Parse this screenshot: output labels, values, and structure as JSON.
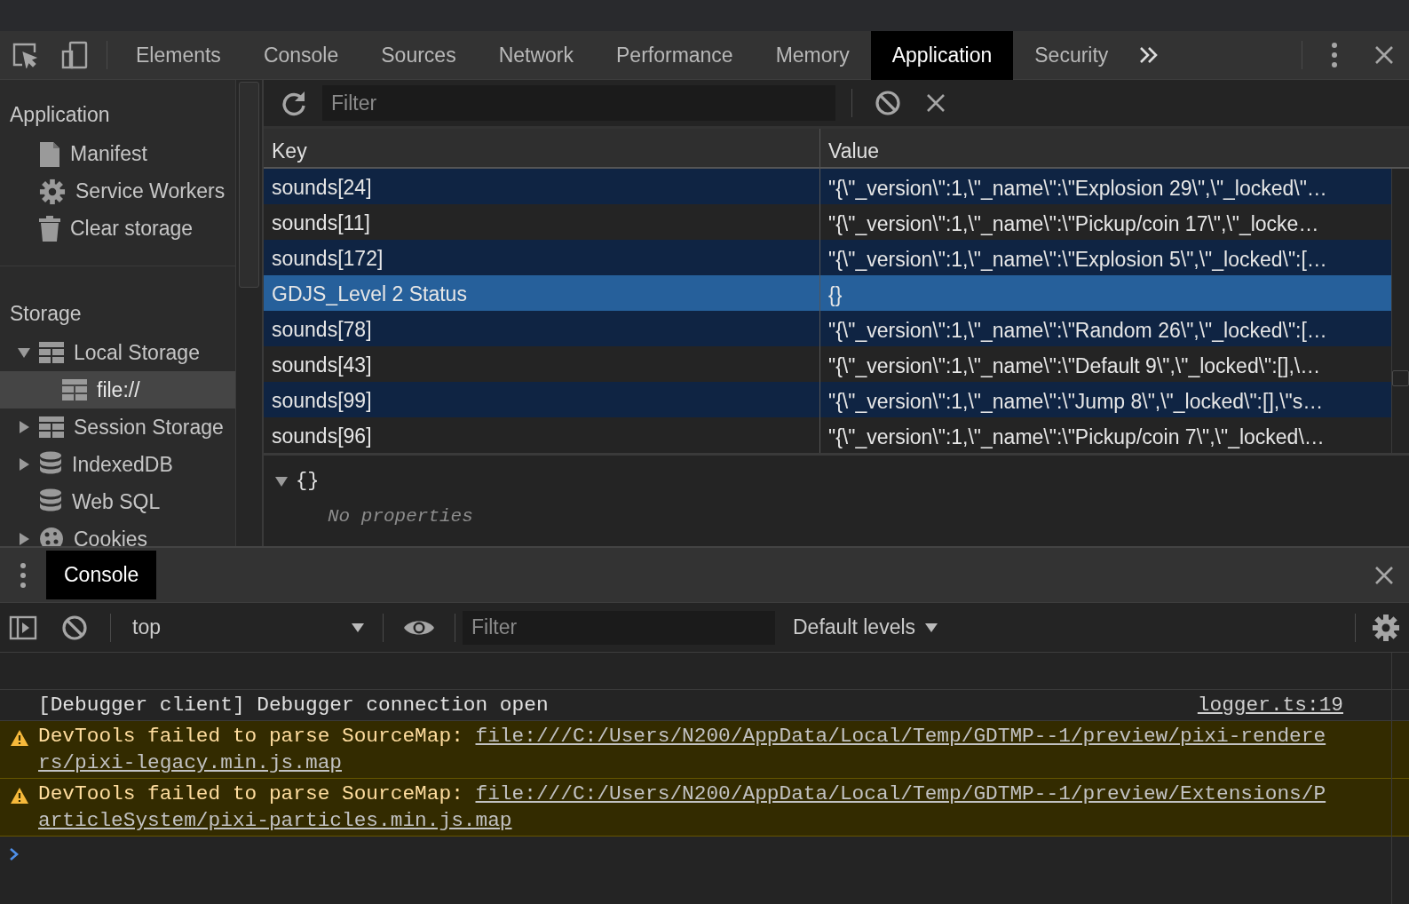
{
  "main_tabs": [
    {
      "label": "Elements",
      "selected": false
    },
    {
      "label": "Console",
      "selected": false
    },
    {
      "label": "Sources",
      "selected": false
    },
    {
      "label": "Network",
      "selected": false
    },
    {
      "label": "Performance",
      "selected": false
    },
    {
      "label": "Memory",
      "selected": false
    },
    {
      "label": "Application",
      "selected": true
    },
    {
      "label": "Security",
      "selected": false
    }
  ],
  "sidebar": {
    "sections": [
      {
        "title": "Application",
        "items": [
          {
            "label": "Manifest",
            "kind": "document",
            "selected": false
          },
          {
            "label": "Service Workers",
            "kind": "gear",
            "selected": false
          },
          {
            "label": "Clear storage",
            "kind": "trash",
            "selected": false
          }
        ]
      },
      {
        "title": "Storage",
        "items": [
          {
            "label": "Local Storage",
            "kind": "table",
            "selected": false,
            "expanded": true,
            "children": [
              {
                "label": "file://",
                "kind": "table",
                "selected": true
              }
            ]
          },
          {
            "label": "Session Storage",
            "kind": "table",
            "selected": false,
            "expanded": false
          },
          {
            "label": "IndexedDB",
            "kind": "database",
            "selected": false,
            "expanded": false
          },
          {
            "label": "Web SQL",
            "kind": "database",
            "selected": false
          },
          {
            "label": "Cookies",
            "kind": "cookie",
            "selected": false,
            "expanded": false
          }
        ]
      }
    ]
  },
  "storage_toolbar": {
    "filter_placeholder": "Filter"
  },
  "table": {
    "columns": [
      "Key",
      "Value"
    ],
    "rows": [
      {
        "key": "sounds[24]",
        "value": "\"{\\\"_version\\\":1,\\\"_name\\\":\\\"Explosion 29\\\",\\\"_locked\\\"…",
        "selected": false
      },
      {
        "key": "sounds[11]",
        "value": "\"{\\\"_version\\\":1,\\\"_name\\\":\\\"Pickup/coin 17\\\",\\\"_locke…",
        "selected": false
      },
      {
        "key": "sounds[172]",
        "value": "\"{\\\"_version\\\":1,\\\"_name\\\":\\\"Explosion 5\\\",\\\"_locked\\\":[…",
        "selected": false
      },
      {
        "key": "GDJS_Level 2 Status",
        "value": "{}",
        "selected": true
      },
      {
        "key": "sounds[78]",
        "value": "\"{\\\"_version\\\":1,\\\"_name\\\":\\\"Random 26\\\",\\\"_locked\\\":[…",
        "selected": false
      },
      {
        "key": "sounds[43]",
        "value": "\"{\\\"_version\\\":1,\\\"_name\\\":\\\"Default 9\\\",\\\"_locked\\\":[],\\…",
        "selected": false
      },
      {
        "key": "sounds[99]",
        "value": "\"{\\\"_version\\\":1,\\\"_name\\\":\\\"Jump 8\\\",\\\"_locked\\\":[],\\\"s…",
        "selected": false
      },
      {
        "key": "sounds[96]",
        "value": "\"{\\\"_version\\\":1,\\\"_name\\\":\\\"Pickup/coin 7\\\",\\\"_locked\\…",
        "selected": false
      }
    ]
  },
  "preview": {
    "object": "{}",
    "expanded": true,
    "empty_text": "No properties"
  },
  "drawer": {
    "tabs": [
      {
        "label": "Console",
        "selected": true
      }
    ],
    "context": "top",
    "filter_placeholder": "Filter",
    "levels": "Default levels"
  },
  "console": {
    "messages": [
      {
        "kind": "info",
        "text": "[Debugger client] Debugger connection open",
        "source": "logger.ts:19"
      },
      {
        "kind": "warning",
        "text": "DevTools failed to parse SourceMap:",
        "link": "file:///C:/Users/N200/AppData/Local/Temp/GDTMP--1/preview/pixi-renderers/pixi-legacy.min.js.map"
      },
      {
        "kind": "warning",
        "text": "DevTools failed to parse SourceMap:",
        "link": "file:///C:/Users/N200/AppData/Local/Temp/GDTMP--1/preview/Extensions/ParticleSystem/pixi-particles.min.js.map"
      }
    ]
  }
}
